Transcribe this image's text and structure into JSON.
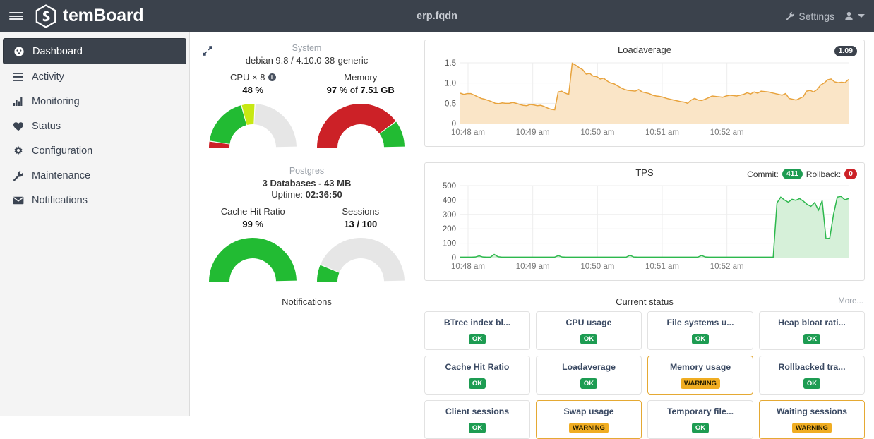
{
  "navbar": {
    "menu_icon": "hamburger-icon",
    "brand": "temBoard",
    "title": "erp.fqdn",
    "settings_label": "Settings",
    "settings_icon": "wrench-icon",
    "user_icon": "user-icon"
  },
  "sidebar": {
    "items": [
      {
        "label": "Dashboard",
        "icon": "dashboard-gauge-icon",
        "active": true
      },
      {
        "label": "Activity",
        "icon": "list-icon",
        "active": false
      },
      {
        "label": "Monitoring",
        "icon": "bar-chart-icon",
        "active": false
      },
      {
        "label": "Status",
        "icon": "heart-icon",
        "active": false
      },
      {
        "label": "Configuration",
        "icon": "gear-icon",
        "active": false
      },
      {
        "label": "Maintenance",
        "icon": "wrench-icon",
        "active": false
      },
      {
        "label": "Notifications",
        "icon": "envelope-icon",
        "active": false
      }
    ]
  },
  "system": {
    "expand_icon": "expand-arrows-icon",
    "caption": "System",
    "detail": "debian 9.8 / 4.10.0-38-generic",
    "gauges": [
      {
        "title": "CPU × 8",
        "has_info": true,
        "value": "48 %",
        "value_pct": 48,
        "segments": [
          {
            "from": 0,
            "to": 5,
            "color": "#cc2127"
          },
          {
            "from": 5,
            "to": 42,
            "color": "#22bb33"
          },
          {
            "from": 42,
            "to": 52,
            "color": "#c7e813"
          },
          {
            "from": 52,
            "to": 100,
            "color": "#e6e6e6"
          }
        ]
      },
      {
        "title": "Memory",
        "has_info": false,
        "value_prefix": "97 %",
        "value_suffix": " of ",
        "value_total": "7.51 GB",
        "value_pct": 97,
        "segments": [
          {
            "from": 0,
            "to": 80,
            "color": "#cc2127"
          },
          {
            "from": 80,
            "to": 100,
            "color": "#22bb33"
          }
        ]
      }
    ]
  },
  "postgres": {
    "caption": "Postgres",
    "databases": "3 Databases - 43 MB",
    "uptime_label": "Uptime: ",
    "uptime_value": "02:36:50",
    "gauges": [
      {
        "title": "Cache Hit Ratio",
        "value": "99 %",
        "value_pct": 99,
        "segments": [
          {
            "from": 0,
            "to": 100,
            "color": "#22bb33"
          }
        ]
      },
      {
        "title": "Sessions",
        "value": "13 / 100",
        "value_pct": 13,
        "segments": [
          {
            "from": 0,
            "to": 13,
            "color": "#22bb33"
          },
          {
            "from": 13,
            "to": 100,
            "color": "#e6e6e6"
          }
        ]
      }
    ]
  },
  "notifications": {
    "title": "Notifications"
  },
  "status": {
    "title": "Current status",
    "more_label": "More...",
    "cards": [
      {
        "title": "BTree index bl...",
        "state": "OK",
        "level": "ok"
      },
      {
        "title": "CPU usage",
        "state": "OK",
        "level": "ok"
      },
      {
        "title": "File systems u...",
        "state": "OK",
        "level": "ok"
      },
      {
        "title": "Heap bloat rati...",
        "state": "OK",
        "level": "ok"
      },
      {
        "title": "Cache Hit Ratio",
        "state": "OK",
        "level": "ok"
      },
      {
        "title": "Loadaverage",
        "state": "OK",
        "level": "ok"
      },
      {
        "title": "Memory usage",
        "state": "WARNING",
        "level": "warn"
      },
      {
        "title": "Rollbacked tra...",
        "state": "OK",
        "level": "ok"
      },
      {
        "title": "Client sessions",
        "state": "OK",
        "level": "ok"
      },
      {
        "title": "Swap usage",
        "state": "WARNING",
        "level": "warn"
      },
      {
        "title": "Temporary file...",
        "state": "OK",
        "level": "ok"
      },
      {
        "title": "Waiting sessions",
        "state": "WARNING",
        "level": "warn"
      }
    ]
  },
  "chart_data": [
    {
      "type": "area",
      "name": "loadaverage",
      "title": "Loadaverage",
      "badge": "1.09",
      "badge_color": "#3b424c",
      "line_color": "#e8a33d",
      "fill_color": "#fae5c7",
      "xlabel": "",
      "ylabel": "",
      "ylim": [
        0,
        1.5
      ],
      "yticks": [
        0,
        0.5,
        1.0,
        1.5
      ],
      "ytick_labels": [
        "0",
        "0.5",
        "1.0",
        "1.5"
      ],
      "xticks": [
        "10:48 am",
        "10:49 am",
        "10:50 am",
        "10:51 am",
        "10:52 am"
      ],
      "grid": true,
      "values": [
        0.75,
        0.72,
        0.74,
        0.74,
        0.7,
        0.66,
        0.62,
        0.6,
        0.57,
        0.54,
        0.5,
        0.49,
        0.51,
        0.5,
        0.5,
        0.52,
        0.5,
        0.47,
        0.45,
        0.44,
        0.47,
        0.46,
        0.44,
        0.45,
        0.42,
        0.38,
        0.35,
        0.34,
        0.78,
        0.8,
        0.75,
        0.72,
        1.49,
        1.44,
        1.38,
        1.33,
        1.22,
        1.24,
        1.17,
        1.16,
        1.1,
        1.12,
        1.05,
        1.0,
        0.98,
        0.93,
        0.88,
        0.84,
        0.82,
        0.81,
        0.8,
        0.84,
        0.78,
        0.76,
        0.74,
        0.7,
        0.68,
        0.67,
        0.65,
        0.62,
        0.6,
        0.58,
        0.56,
        0.54,
        0.53,
        0.5,
        0.58,
        0.62,
        0.58,
        0.57,
        0.6,
        0.64,
        0.68,
        0.67,
        0.66,
        0.65,
        0.68,
        0.7,
        0.69,
        0.68,
        0.7,
        0.72,
        0.76,
        0.73,
        0.78,
        0.75,
        0.8,
        0.79,
        0.78,
        0.76,
        0.74,
        0.72,
        0.7,
        0.74,
        0.62,
        0.6,
        0.58,
        0.62,
        0.66,
        0.8,
        0.82,
        0.78,
        0.84,
        0.95,
        1.0,
        1.08,
        1.1,
        1.03,
        1.01,
        1.02,
        1.01,
        1.09
      ]
    },
    {
      "type": "area",
      "name": "tps",
      "title": "TPS",
      "commit_label": "Commit:",
      "commit_value": "411",
      "rollback_label": "Rollback:",
      "rollback_value": "0",
      "line_color": "#2db84d",
      "fill_color": "#d6f0d9",
      "xlabel": "",
      "ylabel": "",
      "ylim": [
        0,
        500
      ],
      "yticks": [
        0,
        100,
        200,
        300,
        400,
        500
      ],
      "ytick_labels": [
        "0",
        "100",
        "200",
        "300",
        "400",
        "500"
      ],
      "xticks": [
        "10:48 am",
        "10:49 am",
        "10:50 am",
        "10:51 am",
        "10:52 am"
      ],
      "grid": true,
      "values": [
        3,
        3,
        3,
        3,
        4,
        12,
        4,
        3,
        3,
        22,
        6,
        3,
        3,
        3,
        3,
        3,
        3,
        3,
        3,
        3,
        3,
        3,
        3,
        3,
        3,
        3,
        14,
        4,
        3,
        3,
        3,
        3,
        3,
        3,
        3,
        3,
        3,
        3,
        3,
        3,
        3,
        3,
        3,
        3,
        3,
        16,
        4,
        3,
        3,
        3,
        3,
        3,
        3,
        3,
        3,
        3,
        3,
        3,
        3,
        3,
        3,
        3,
        3,
        3,
        15,
        4,
        3,
        3,
        3,
        3,
        3,
        3,
        3,
        3,
        3,
        3,
        3,
        3,
        3,
        3,
        3,
        3,
        3,
        3,
        380,
        420,
        400,
        385,
        405,
        398,
        410,
        392,
        370,
        356,
        382,
        330,
        396,
        132,
        135,
        300,
        420,
        425,
        402,
        410
      ]
    }
  ]
}
